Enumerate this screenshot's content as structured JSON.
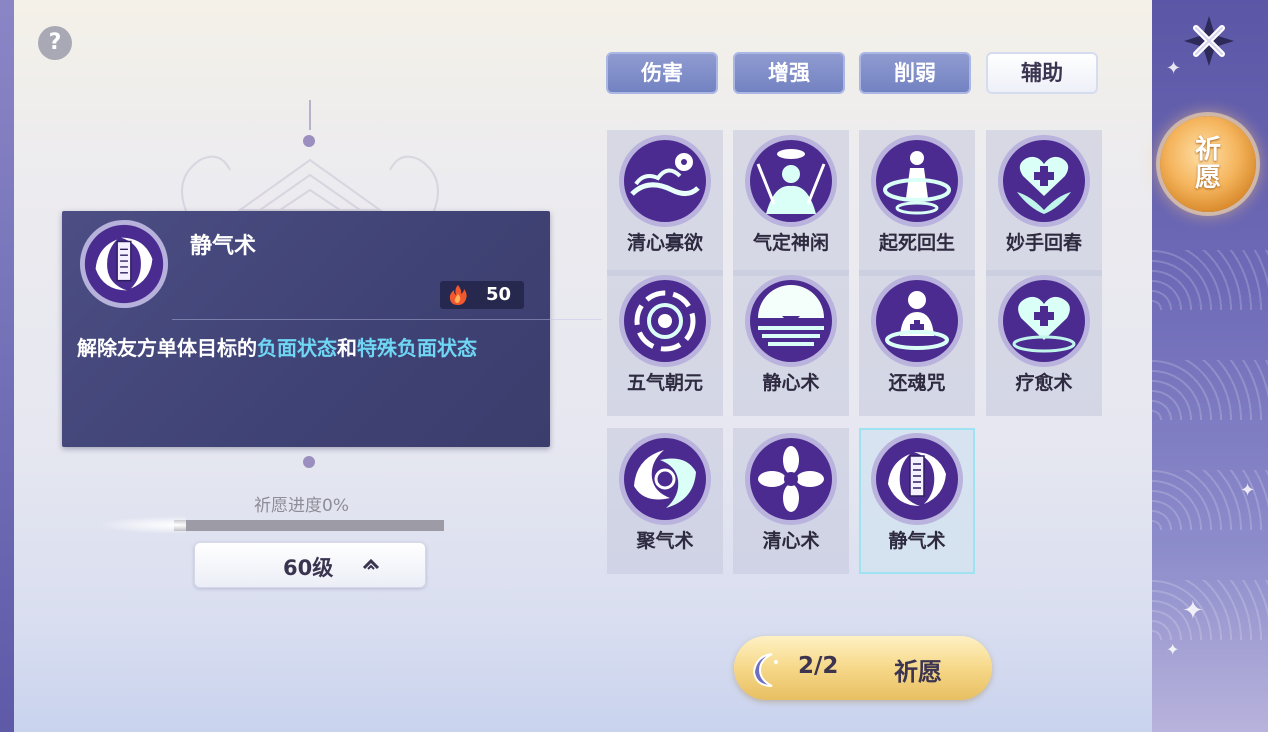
{
  "help": {
    "label": "?"
  },
  "tabs": [
    {
      "label": "伤害",
      "active": false
    },
    {
      "label": "增强",
      "active": false
    },
    {
      "label": "削弱",
      "active": false
    },
    {
      "label": "辅助",
      "active": true
    }
  ],
  "skills": [
    {
      "name": "清心寡欲",
      "icon": "cloud-flower-icon"
    },
    {
      "name": "气定神闲",
      "icon": "meditating-figure-icon"
    },
    {
      "name": "起死回生",
      "icon": "revive-figure-icon"
    },
    {
      "name": "妙手回春",
      "icon": "heart-cross-leaf-icon"
    },
    {
      "name": "五气朝元",
      "icon": "spiral-vortex-icon"
    },
    {
      "name": "静心术",
      "icon": "moon-boat-icon"
    },
    {
      "name": "还魂咒",
      "icon": "soul-figure-icon"
    },
    {
      "name": "疗愈术",
      "icon": "heart-cross-icon"
    },
    {
      "name": "聚气术",
      "icon": "swirl-icon"
    },
    {
      "name": "清心术",
      "icon": "flower-icon"
    },
    {
      "name": "静气术",
      "icon": "talisman-swirl-icon",
      "selected": true
    }
  ],
  "detail": {
    "name": "静气术",
    "icon": "talisman-swirl-icon",
    "cost_icon": "fire-icon",
    "cost": "50",
    "desc_pre": "解除友方单体目标的",
    "desc_hl1": "负面状态",
    "desc_mid": "和",
    "desc_hl2": "特殊负面状态",
    "highlight_color": "#6fd6f4"
  },
  "progress": {
    "label": "祈愿进度0%",
    "value": 0
  },
  "level": {
    "label": "60级"
  },
  "wish": {
    "count": "2/2",
    "label": "祈愿"
  },
  "side": {
    "pray_label": "祈愿",
    "close_icon": "close-icon"
  }
}
